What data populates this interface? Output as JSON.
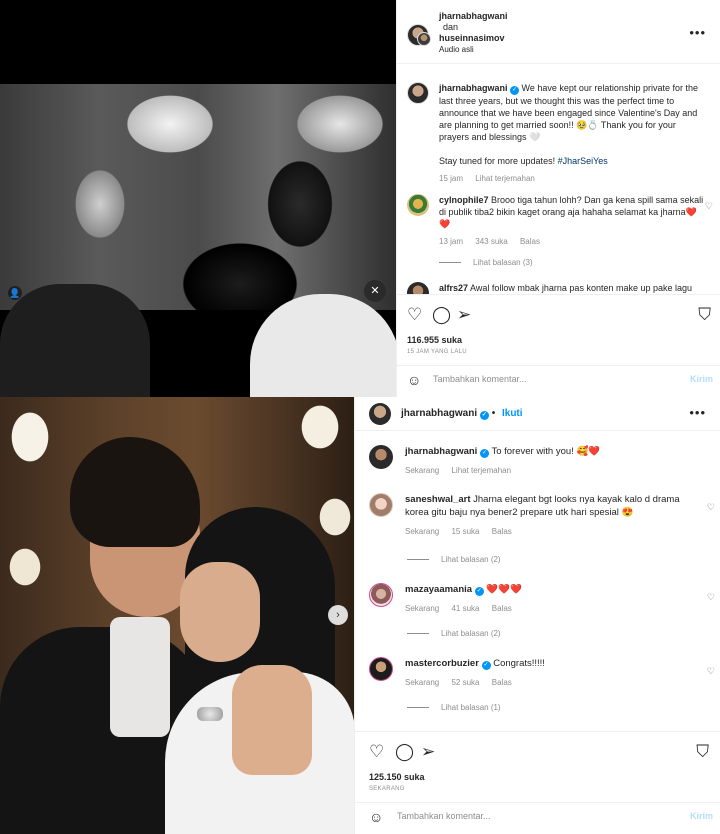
{
  "post1": {
    "header": {
      "user1": "jharnabhagwani",
      "connector": "dan",
      "user2": "huseinnasimov",
      "audio": "Audio asli"
    },
    "caption": {
      "username": "jharnabhagwani",
      "text": "We have kept our relationship private for the last three years, but we thought this was the perfect time to announce that we have been engaged since Valentine's Day and are planning to get married soon!! 🥹💍 Thank you for your prayers and blessings 🤍",
      "text2": "Stay tuned for more updates!",
      "hashtag": "#JharSeiYes",
      "time": "15 jam",
      "translate": "Lihat terjemahan"
    },
    "comments": [
      {
        "username": "cylnophile7",
        "text": "Brooo tiga tahun lohh? Dan ga kena spill sama sekali di publik tiba2 bikin kaget orang aja hahaha selamat ka jharna❤️❤️",
        "time": "13 jam",
        "likes": "343 suka",
        "reply": "Balas",
        "view_replies": "Lihat balasan (3)"
      },
      {
        "username": "alfrs27",
        "text": "Awal follow mbak jharna pas konten make up pake lagu"
      }
    ],
    "likes": "116.955 suka",
    "time_caps": "15 JAM YANG LALU",
    "add_comment_placeholder": "Tambahkan komentar...",
    "post_label": "Kirim"
  },
  "post2": {
    "header": {
      "username": "jharnabhagwani",
      "follow": "Ikuti"
    },
    "caption": {
      "username": "jharnabhagwani",
      "text": "To forever with you! 🥰❤️",
      "time": "Sekarang",
      "translate": "Lihat terjemahan"
    },
    "comments": [
      {
        "username": "saneshwal_art",
        "text": "Jharna elegant bgt looks nya kayak kalo d drama korea gitu baju nya bener2 prepare utk hari spesial 😍",
        "time": "Sekarang",
        "likes": "15 suka",
        "reply": "Balas",
        "view_replies": "Lihat balasan (2)"
      },
      {
        "username": "mazayaamania",
        "text": "❤️❤️❤️",
        "time": "Sekarang",
        "likes": "41 suka",
        "reply": "Balas",
        "view_replies": "Lihat balasan (2)"
      },
      {
        "username": "mastercorbuzier",
        "text": "Congrats!!!!!",
        "time": "Sekarang",
        "likes": "52 suka",
        "reply": "Balas",
        "view_replies": "Lihat balasan (1)"
      }
    ],
    "likes": "125.150 suka",
    "time_caps": "SEKARANG",
    "add_comment_placeholder": "Tambahkan komentar...",
    "post_label": "Kirim"
  },
  "icons": {
    "heart": "♡",
    "comment": "◯",
    "share": "➢",
    "bookmark": "⛉",
    "emoji": "☺",
    "more": "•••",
    "verified": "✓",
    "next": "›",
    "mute": "🔇",
    "user": "👤"
  },
  "colors": {
    "accent": "#0095f6",
    "link": "#00376b",
    "muted": "#8e8e8e",
    "post_disabled": "#b2dffc"
  }
}
